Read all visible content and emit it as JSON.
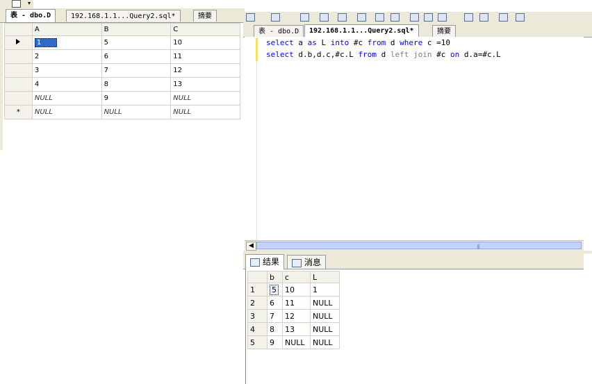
{
  "left": {
    "tabs": [
      {
        "label": "表 - dbo.D",
        "active": true
      },
      {
        "label": "192.168.1.1...Query2.sql*",
        "active": false
      },
      {
        "label": "摘要",
        "active": false
      }
    ],
    "grid": {
      "columns": [
        "A",
        "B",
        "C"
      ],
      "rows": [
        {
          "marker": "arrow",
          "cells": [
            "1",
            "5",
            "10"
          ]
        },
        {
          "marker": "",
          "cells": [
            "2",
            "6",
            "11"
          ]
        },
        {
          "marker": "",
          "cells": [
            "3",
            "7",
            "12"
          ]
        },
        {
          "marker": "",
          "cells": [
            "4",
            "8",
            "13"
          ]
        },
        {
          "marker": "",
          "cells": [
            "NULL",
            "9",
            "NULL"
          ]
        },
        {
          "marker": "*",
          "cells": [
            "NULL",
            "NULL",
            "NULL"
          ]
        }
      ]
    }
  },
  "right": {
    "tabs": [
      {
        "label": "表 - dbo.D",
        "active": false
      },
      {
        "label": "192.168.1.1...Query2.sql*",
        "active": true
      },
      {
        "label": "摘要",
        "active": false
      }
    ],
    "code": {
      "line1": [
        "select",
        " a ",
        "as",
        " L ",
        "into",
        " #c ",
        "from",
        " d ",
        "where",
        " c =10"
      ],
      "line2": [
        "select",
        " d.b,d.c,#c.L ",
        "from",
        " d ",
        "left join",
        " #c ",
        "on",
        " d.a=#c.L"
      ]
    },
    "result_tabs": [
      {
        "label": "结果",
        "icon": "grid-icon",
        "active": true
      },
      {
        "label": "消息",
        "icon": "message-icon",
        "active": false
      }
    ],
    "results": {
      "columns": [
        "b",
        "c",
        "L"
      ],
      "rows": [
        {
          "n": "1",
          "cells": [
            "5",
            "10",
            "1"
          ]
        },
        {
          "n": "2",
          "cells": [
            "6",
            "11",
            "NULL"
          ]
        },
        {
          "n": "3",
          "cells": [
            "7",
            "12",
            "NULL"
          ]
        },
        {
          "n": "4",
          "cells": [
            "8",
            "13",
            "NULL"
          ]
        },
        {
          "n": "5",
          "cells": [
            "9",
            "NULL",
            "NULL"
          ]
        }
      ]
    }
  }
}
